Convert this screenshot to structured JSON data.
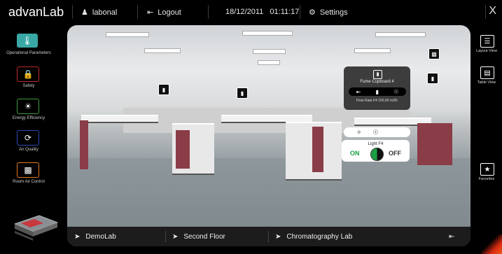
{
  "topbar": {
    "brand": "advanLab",
    "user": "labonal",
    "logout": "Logout",
    "datetime": "18/12/2011   01:11:17",
    "settings": "Settings",
    "close": "X"
  },
  "leftbar": {
    "items": [
      {
        "label": "Operational Parameters",
        "icon": "thermometer-icon",
        "color": "#39a8a5"
      },
      {
        "label": "Safety",
        "icon": "lock-icon",
        "color": "#c0282c"
      },
      {
        "label": "Energy Efficiency",
        "icon": "bulb-icon",
        "color": "#3a9c3a"
      },
      {
        "label": "Air Quality",
        "icon": "air-swirl-icon",
        "color": "#2e4bb5"
      },
      {
        "label": "Room Air Control",
        "icon": "air-control-icon",
        "color": "#e07a1c"
      }
    ]
  },
  "popup": {
    "title": "Fume Cupboard 4",
    "flow": "Flow Rate F4   100.00  m3/h"
  },
  "light": {
    "title": "Light F4",
    "on": "ON",
    "off": "OFF"
  },
  "breadcrumbs": [
    {
      "label": "DemoLab"
    },
    {
      "label": "Second Floor"
    },
    {
      "label": "Chromatography Lab"
    }
  ],
  "rightbar": {
    "layout_view": "Layout View",
    "table_view": "Table View",
    "favorites": "Favorites"
  }
}
